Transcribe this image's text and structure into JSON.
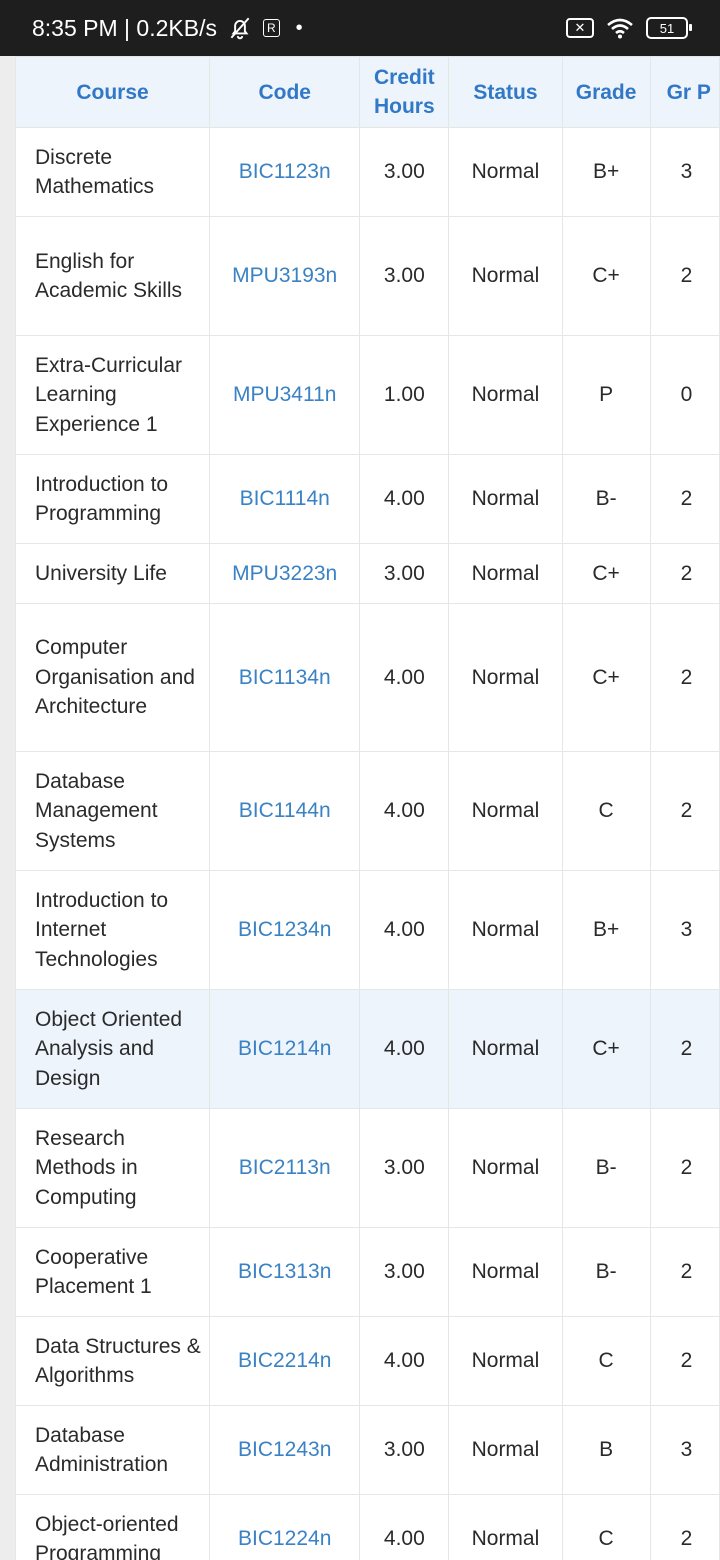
{
  "status_bar": {
    "time_speed": "8:35 PM | 0.2KB/s",
    "badge": "R",
    "battery": "51"
  },
  "table": {
    "headers": {
      "course": "Course",
      "code": "Code",
      "credit_hours": "Credit Hours",
      "status": "Status",
      "grade": "Grade",
      "grade_point": "Gr P"
    },
    "rows": [
      {
        "course": "Discrete Mathematics",
        "code": "BIC1123n",
        "credit": "3.00",
        "status": "Normal",
        "grade": "B+",
        "gp": "3"
      },
      {
        "course": "English for Academic Skills",
        "code": "MPU3193n",
        "credit": "3.00",
        "status": "Normal",
        "grade": "C+",
        "gp": "2"
      },
      {
        "course": "Extra-Curricular Learning Experience 1",
        "code": "MPU3411n",
        "credit": "1.00",
        "status": "Normal",
        "grade": "P",
        "gp": "0"
      },
      {
        "course": "Introduction to Programming",
        "code": "BIC1114n",
        "credit": "4.00",
        "status": "Normal",
        "grade": "B-",
        "gp": "2"
      },
      {
        "course": "University Life",
        "code": "MPU3223n",
        "credit": "3.00",
        "status": "Normal",
        "grade": "C+",
        "gp": "2"
      },
      {
        "course": "Computer Organisation and Architecture",
        "code": "BIC1134n",
        "credit": "4.00",
        "status": "Normal",
        "grade": "C+",
        "gp": "2"
      },
      {
        "course": "Database Management Systems",
        "code": "BIC1144n",
        "credit": "4.00",
        "status": "Normal",
        "grade": "C",
        "gp": "2"
      },
      {
        "course": "Introduction to Internet Technologies",
        "code": "BIC1234n",
        "credit": "4.00",
        "status": "Normal",
        "grade": "B+",
        "gp": "3"
      },
      {
        "course": "Object Oriented Analysis and Design",
        "code": "BIC1214n",
        "credit": "4.00",
        "status": "Normal",
        "grade": "C+",
        "gp": "2"
      },
      {
        "course": "Research Methods in Computing",
        "code": "BIC2113n",
        "credit": "3.00",
        "status": "Normal",
        "grade": "B-",
        "gp": "2"
      },
      {
        "course": "Cooperative Placement 1",
        "code": "BIC1313n",
        "credit": "3.00",
        "status": "Normal",
        "grade": "B-",
        "gp": "2"
      },
      {
        "course": "Data Structures & Algorithms",
        "code": "BIC2214n",
        "credit": "4.00",
        "status": "Normal",
        "grade": "C",
        "gp": "2"
      },
      {
        "course": "Database Administration",
        "code": "BIC1243n",
        "credit": "3.00",
        "status": "Normal",
        "grade": "B",
        "gp": "3"
      },
      {
        "course": "Object-oriented Programming",
        "code": "BIC1224n",
        "credit": "4.00",
        "status": "Normal",
        "grade": "C",
        "gp": "2"
      }
    ]
  }
}
